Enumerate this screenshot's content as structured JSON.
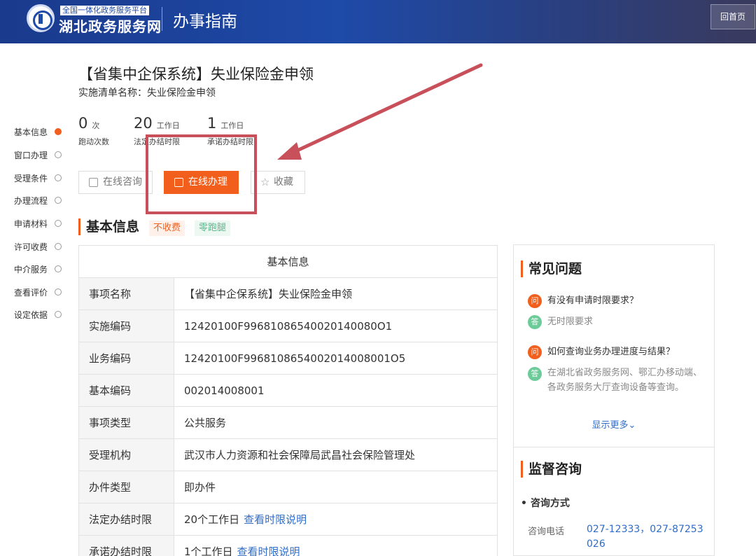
{
  "header": {
    "logo_small": "全国一体化政务服务平台",
    "logo_big": "湖北政务服务网",
    "title": "办事指南",
    "home_button": "回首页"
  },
  "page": {
    "title": "【省集中企保系统】失业保险金申领",
    "subtitle": "实施清单名称：失业保险金申领"
  },
  "stats": [
    {
      "num": "0",
      "unit": "次",
      "label": "跑动次数"
    },
    {
      "num": "20",
      "unit": "工作日",
      "label": "法定办结时限"
    },
    {
      "num": "1",
      "unit": "工作日",
      "label": "承诺办结时限"
    }
  ],
  "actions": {
    "consult": "在线咨询",
    "online": "在线办理",
    "favorite": "收藏"
  },
  "side_nav": [
    {
      "label": "基本信息",
      "active": true
    },
    {
      "label": "窗口办理",
      "active": false
    },
    {
      "label": "受理条件",
      "active": false
    },
    {
      "label": "办理流程",
      "active": false
    },
    {
      "label": "申请材料",
      "active": false
    },
    {
      "label": "许可收费",
      "active": false
    },
    {
      "label": "中介服务",
      "active": false
    },
    {
      "label": "查看评价",
      "active": false
    },
    {
      "label": "设定依据",
      "active": false
    }
  ],
  "section": {
    "title": "基本信息",
    "tag_free": "不收费",
    "tag_zero": "零跑腿"
  },
  "info_table": {
    "header": "基本信息",
    "rows": [
      {
        "key": "事项名称",
        "value": "【省集中企保系统】失业保险金申领",
        "link": ""
      },
      {
        "key": "实施编码",
        "value": "12420100F99681086540020140080O1",
        "link": ""
      },
      {
        "key": "业务编码",
        "value": "12420100F9968108654002014008001O5",
        "link": ""
      },
      {
        "key": "基本编码",
        "value": "002014008001",
        "link": ""
      },
      {
        "key": "事项类型",
        "value": "公共服务",
        "link": ""
      },
      {
        "key": "受理机构",
        "value": "武汉市人力资源和社会保障局武昌社会保险管理处",
        "link": ""
      },
      {
        "key": "办件类型",
        "value": "即办件",
        "link": ""
      },
      {
        "key": "法定办结时限",
        "value": "20个工作日",
        "link": "查看时限说明"
      },
      {
        "key": "承诺办结时限",
        "value": "1个工作日",
        "link": "查看时限说明"
      }
    ]
  },
  "faq": {
    "title": "常见问题",
    "q_badge": "问",
    "a_badge": "答",
    "items": [
      {
        "q": "有没有申请时限要求？",
        "a": "无时限要求"
      },
      {
        "q": "如何查询业务办理进度与结果？",
        "a": "在湖北省政务服务网、鄂汇办移动端、各政务服务大厅查询设备等查询。"
      }
    ],
    "more": "显示更多⌄"
  },
  "supervision": {
    "title": "监督咨询",
    "way_label": "• 咨询方式",
    "phone_label": "咨询电话",
    "phone_value": "027-12333，027-87253026"
  },
  "colors": {
    "brand_blue": "#1e4aa8",
    "accent_orange": "#f25e1c",
    "annotation_red": "#c8505a",
    "link_blue": "#2f6cc8"
  }
}
